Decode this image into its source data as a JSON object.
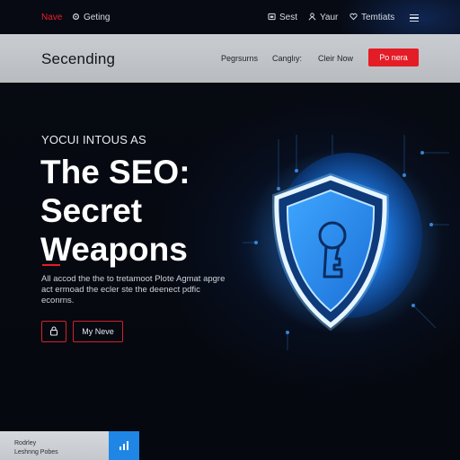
{
  "topnav": {
    "items": [
      {
        "label": "Nave",
        "active": true
      },
      {
        "label": "Geting",
        "icon": "gear-icon"
      },
      {
        "label": "Sest",
        "icon": "calendar-icon"
      },
      {
        "label": "Yaur",
        "icon": "person-icon"
      },
      {
        "label": "Temtiats",
        "icon": "heart-icon"
      }
    ],
    "menu_icon": "hamburger-menu-icon"
  },
  "header": {
    "brand": "Secending",
    "links": [
      "Pegrsurns",
      "Canglıy:",
      "Cleir Now"
    ],
    "cta_label": "Po nera"
  },
  "hero": {
    "eyebrow": "YOCUI INTOUS AS",
    "headline_lines": [
      "The SEO:",
      "Secret",
      "Weapons"
    ],
    "description": "All accod the the to tretamoot Plote Agmat apgre act ermoad the ecler ste the deenect pdfic econrns.",
    "icon_button_glyph": "lock-icon",
    "more_button_label": "My Neve"
  },
  "bottom_card": {
    "line1": "Rodrley",
    "line2": "Leshnng Pobes",
    "chip_icon": "bar-chart-icon"
  },
  "colors": {
    "accent_red": "#e41c26",
    "shield_blue": "#2a8ff0",
    "glow_blue": "#39a7ff",
    "background": "#05080f"
  }
}
